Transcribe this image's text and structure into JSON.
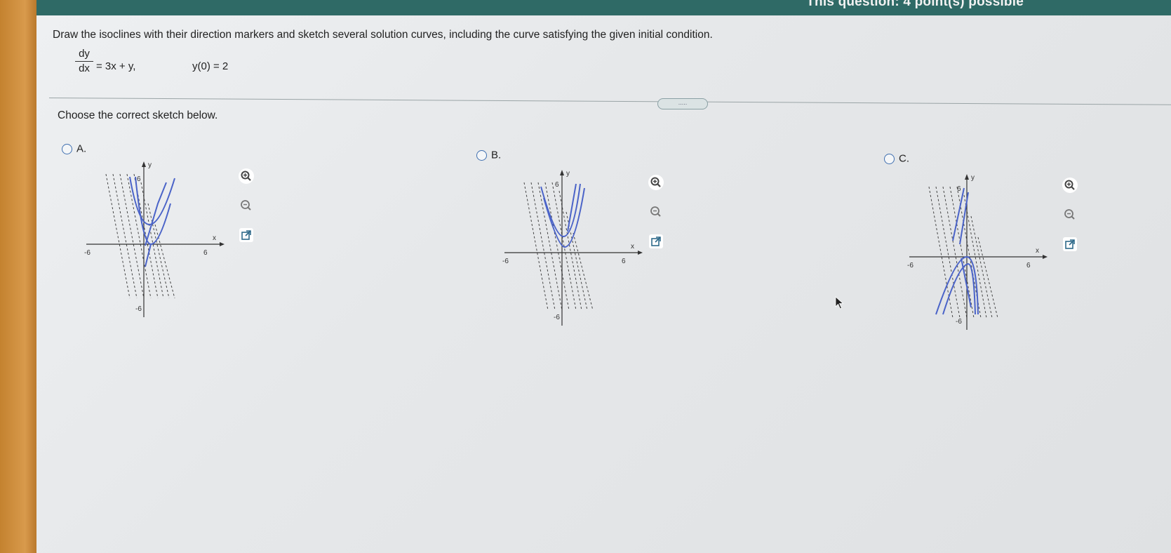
{
  "header": {
    "status_text": "This question: 4 point(s) possible"
  },
  "question": {
    "prompt": "Draw the isoclines with their direction markers and sketch several solution curves, including the curve satisfying the given initial condition.",
    "eq_num": "dy",
    "eq_den": "dx",
    "eq_rhs": "= 3x + y,",
    "initial_condition": "y(0) = 2",
    "more_pill": "....."
  },
  "choose_text": "Choose the correct sketch below.",
  "options": [
    {
      "label": "A.",
      "selected": false,
      "x_axis": "x",
      "y_axis": "y",
      "x_min_tick": "-6",
      "x_max_tick": "6",
      "y_max_tick": "6",
      "y_min_tick": "-6"
    },
    {
      "label": "B.",
      "selected": false,
      "x_axis": "x",
      "y_axis": "y",
      "x_min_tick": "-6",
      "x_max_tick": "6",
      "y_max_tick": "6",
      "y_min_tick": "-6"
    },
    {
      "label": "C.",
      "selected": false,
      "x_axis": "x",
      "y_axis": "y",
      "x_min_tick": "-6",
      "x_max_tick": "6",
      "y_max_tick": "6",
      "y_min_tick": "-6"
    }
  ],
  "tool_icons": [
    "zoom-in-icon",
    "zoom-out-icon",
    "open-new-window-icon"
  ],
  "colors": {
    "accent": "#2f6a66",
    "curve": "#4a63c8",
    "radio": "#3f6fb0"
  }
}
